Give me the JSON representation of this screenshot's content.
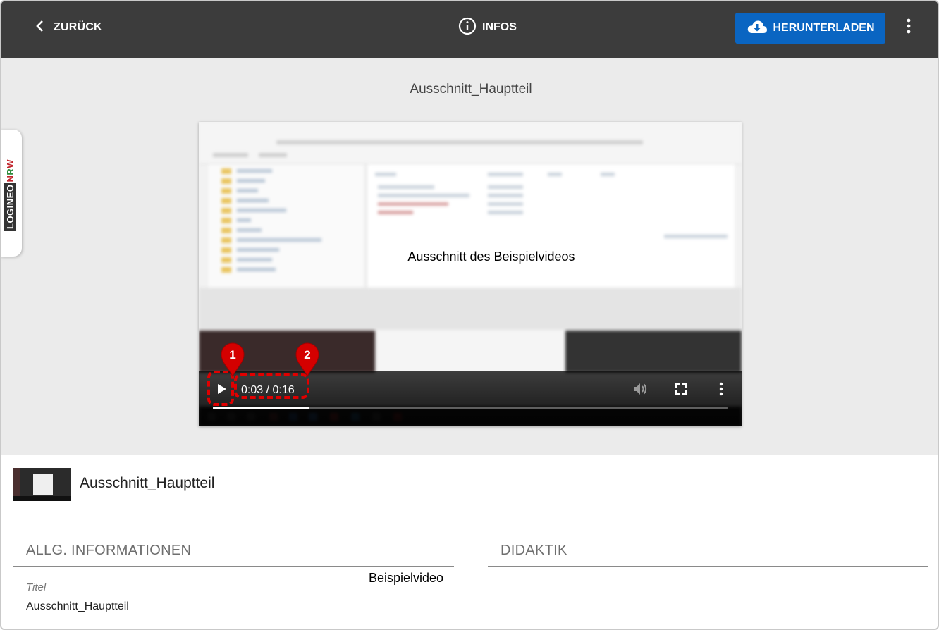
{
  "topbar": {
    "back_label": "ZURÜCK",
    "info_label": "INFOS",
    "download_label": "HERUNTERLADEN"
  },
  "stage": {
    "title": "Ausschnitt_Hauptteil"
  },
  "brand": {
    "logineo": "LOGINEO",
    "n": "N",
    "r": "R",
    "w": "W"
  },
  "video": {
    "overlay_caption": "Ausschnitt des Beispielvideos",
    "time_display": "0:03 / 0:16",
    "progress": 0.1875
  },
  "annotations": [
    {
      "number": "1"
    },
    {
      "number": "2"
    }
  ],
  "item": {
    "title": "Ausschnitt_Hauptteil"
  },
  "sections": {
    "general": "ALLG. INFORMATIONEN",
    "didactics": "DIDAKTIK"
  },
  "fields": {
    "title_label": "Titel",
    "title_value": "Ausschnitt_Hauptteil"
  },
  "caption_beispielvideo": "Beispielvideo",
  "colors": {
    "topbar": "#3c3c3c",
    "download_button": "#0a65c2",
    "annotation": "#e00000",
    "stage_bg": "#ebebeb"
  }
}
